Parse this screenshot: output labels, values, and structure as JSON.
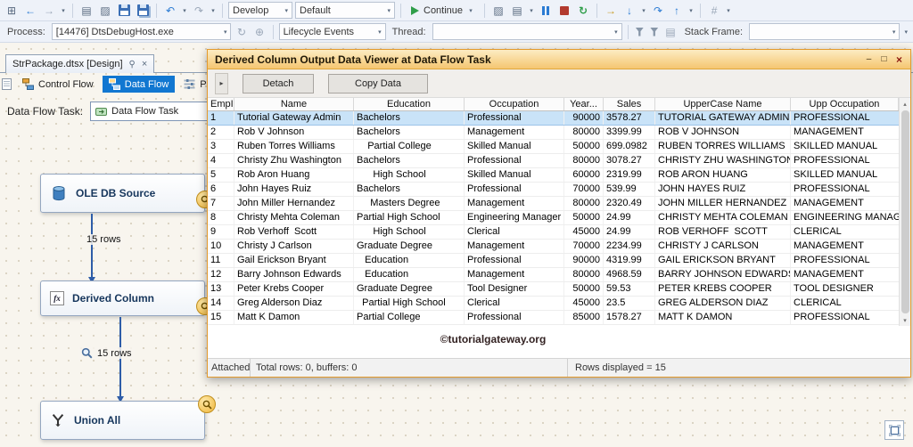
{
  "toolbar": {
    "develop": "Develop",
    "default": "Default",
    "continue_label": "Continue"
  },
  "debug_bar": {
    "process_label": "Process:",
    "process_value": "[14476] DtsDebugHost.exe",
    "lifecycle_label": "Lifecycle Events",
    "thread_label": "Thread:",
    "thread_value": "",
    "stack_frame_label": "Stack Frame:",
    "stack_frame_value": ""
  },
  "document": {
    "tab_title": "StrPackage.dtsx [Design]",
    "design_tabs": [
      {
        "label": "Control Flow",
        "selected": false
      },
      {
        "label": "Data Flow",
        "selected": true
      },
      {
        "label": "Parameters",
        "selected": false
      }
    ],
    "task_label": "Data Flow Task:",
    "task_value": "Data Flow Task"
  },
  "canvas": {
    "nodes": [
      {
        "label": "OLE DB Source"
      },
      {
        "label": "Derived Column"
      },
      {
        "label": "Union All"
      }
    ],
    "edge1_label": "15 rows",
    "edge2_label": "15 rows"
  },
  "dialog": {
    "title": "Derived Column Output Data Viewer at Data Flow Task",
    "detach_label": "Detach",
    "copy_label": "Copy Data",
    "watermark": "©tutorialgateway.org",
    "status_attached": "Attached",
    "status_totals": "Total rows: 0, buffers: 0",
    "status_rows": "Rows displayed = 15"
  },
  "grid": {
    "columns": [
      "EmpID",
      "Name",
      "Education",
      "Occupation",
      "Year...",
      "Sales",
      "UpperCase Name",
      "Upp Occupation"
    ],
    "selected_row_index": 0,
    "rows": [
      [
        "1",
        "Tutorial Gateway Admin",
        "Bachelors",
        "Professional",
        "90000",
        "3578.27",
        "TUTORIAL GATEWAY ADMIN",
        "PROFESSIONAL"
      ],
      [
        "2",
        "Rob V Johnson",
        "Bachelors",
        "Management",
        "80000",
        "3399.99",
        "ROB V JOHNSON",
        "MANAGEMENT"
      ],
      [
        "3",
        "Ruben Torres Williams",
        "    Partial College",
        "Skilled Manual",
        "50000",
        "699.0982",
        "RUBEN TORRES WILLIAMS",
        "SKILLED MANUAL"
      ],
      [
        "4",
        "Christy Zhu Washington",
        "Bachelors",
        "Professional",
        "80000",
        "3078.27",
        "CHRISTY ZHU WASHINGTON",
        "PROFESSIONAL"
      ],
      [
        "5",
        "Rob Aron Huang",
        "      High School",
        "Skilled Manual",
        "60000",
        "2319.99",
        "ROB ARON HUANG",
        "SKILLED MANUAL"
      ],
      [
        "6",
        "John Hayes Ruiz",
        "Bachelors",
        "Professional",
        "70000",
        "539.99",
        "JOHN HAYES RUIZ",
        "PROFESSIONAL"
      ],
      [
        "7",
        "John Miller Hernandez",
        "     Masters Degree",
        "Management",
        "80000",
        "2320.49",
        "JOHN MILLER HERNANDEZ",
        "MANAGEMENT"
      ],
      [
        "8",
        "Christy Mehta Coleman",
        "Partial High School",
        "Engineering Manager",
        "50000",
        "24.99",
        "CHRISTY MEHTA COLEMAN",
        "ENGINEERING MANAGER"
      ],
      [
        "9",
        "Rob Verhoff  Scott",
        "      High School",
        "Clerical",
        "45000",
        "24.99",
        "ROB VERHOFF  SCOTT",
        "CLERICAL"
      ],
      [
        "10",
        "Christy J Carlson",
        "Graduate Degree",
        "Management",
        "70000",
        "2234.99",
        "CHRISTY J CARLSON",
        "MANAGEMENT"
      ],
      [
        "11",
        "Gail Erickson Bryant",
        "   Education",
        "Professional",
        "90000",
        "4319.99",
        "GAIL ERICKSON BRYANT",
        "PROFESSIONAL"
      ],
      [
        "12",
        "Barry Johnson Edwards",
        "   Education",
        "Management",
        "80000",
        "4968.59",
        "BARRY JOHNSON EDWARDS",
        "MANAGEMENT"
      ],
      [
        "13",
        "Peter Krebs Cooper",
        "Graduate Degree",
        "Tool Designer",
        "50000",
        "59.53",
        "PETER KREBS COOPER",
        "TOOL DESIGNER"
      ],
      [
        "14",
        "Greg Alderson Diaz",
        "  Partial High School",
        "Clerical",
        "45000",
        "23.5",
        "GREG ALDERSON DIAZ",
        "CLERICAL"
      ],
      [
        "15",
        "Matt K Damon",
        "Partial College",
        "Professional",
        "85000",
        "1578.27",
        "MATT K DAMON",
        "PROFESSIONAL"
      ]
    ]
  },
  "icons": {
    "window": "⊞",
    "back": "←",
    "forward": "→",
    "chevron": "▾",
    "new_file": "▤",
    "open_file": "▨",
    "undo": "↶",
    "redo": "↷",
    "restart": "↻",
    "show_next": "→",
    "step_into": "↓",
    "step_over": "↷",
    "step_out": "↑",
    "hex": "#",
    "refresh": "↻",
    "add": "⊕",
    "frames": "▤",
    "overflow": "▾",
    "pin": "⚲",
    "close": "×",
    "minimize": "–",
    "maximize": "□",
    "collapse": "▸",
    "scroll_up": "▴",
    "scroll_down": "▾"
  },
  "colors": {
    "accent_blue": "#1177d1",
    "selection_blue": "#c9e3f8",
    "dialog_title": "#f5c671",
    "badge_orange": "#eeb53a",
    "continue_green": "#2f9e4a",
    "stop_red": "#b23a2f"
  }
}
